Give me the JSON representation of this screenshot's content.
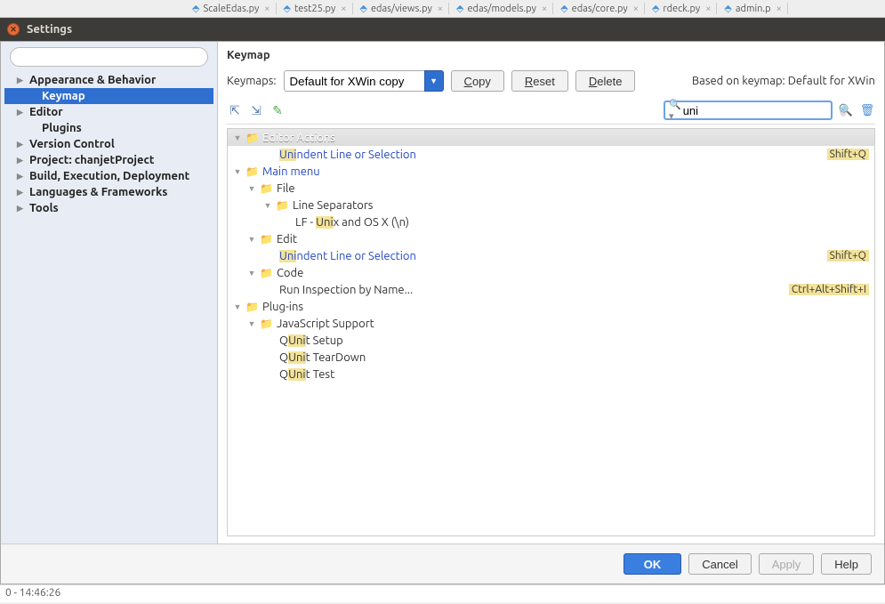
{
  "editorTabs": [
    "ScaleEdas.py",
    "test25.py",
    "edas/views.py",
    "edas/models.py",
    "edas/core.py",
    "rdeck.py",
    "admin.p"
  ],
  "windowTitle": "Settings",
  "sidebar": {
    "items": [
      {
        "label": "Appearance & Behavior",
        "bold": true,
        "arrow": true
      },
      {
        "label": "Keymap",
        "bold": true,
        "selected": true,
        "indent": true
      },
      {
        "label": "Editor",
        "bold": true,
        "arrow": true
      },
      {
        "label": "Plugins",
        "bold": true,
        "indent": true
      },
      {
        "label": "Version Control",
        "bold": true,
        "arrow": true
      },
      {
        "label": "Project: chanjetProject",
        "bold": true,
        "arrow": true
      },
      {
        "label": "Build, Execution, Deployment",
        "bold": true,
        "arrow": true
      },
      {
        "label": "Languages & Frameworks",
        "bold": true,
        "arrow": true
      },
      {
        "label": "Tools",
        "bold": true,
        "arrow": true
      }
    ]
  },
  "main": {
    "title": "Keymap",
    "keymapsLabel": "Keymaps:",
    "keymapsValue": "Default for XWin copy",
    "copy": "Copy",
    "reset": "Reset",
    "delete": "Delete",
    "basedOn": "Based on keymap: Default for XWin",
    "searchValue": "uni"
  },
  "tree": [
    {
      "ind": 0,
      "sel": true,
      "tw": "▼",
      "fold": "blue",
      "label": "Editor Actions",
      "white": true
    },
    {
      "ind": 3,
      "link": true,
      "pre": "",
      "hl": "Uni",
      "post": "ndent Line or Selection",
      "shortcut": "Shift+Q"
    },
    {
      "ind": 0,
      "tw": "▼",
      "fold": "blue",
      "link": true,
      "label": "Main menu"
    },
    {
      "ind": 1,
      "tw": "▼",
      "fold": "y",
      "label": "File"
    },
    {
      "ind": 2,
      "tw": "▼",
      "fold": "y",
      "label": "Line Separators"
    },
    {
      "ind": 4,
      "pre": "LF - ",
      "hl": "Uni",
      "post": "x and OS X (\\n)"
    },
    {
      "ind": 1,
      "tw": "▼",
      "fold": "y",
      "label": "Edit"
    },
    {
      "ind": 3,
      "link": true,
      "pre": "",
      "hl": "Uni",
      "post": "ndent Line or Selection",
      "shortcut": "Shift+Q"
    },
    {
      "ind": 1,
      "tw": "▼",
      "fold": "y",
      "label": "Code"
    },
    {
      "ind": 3,
      "label": "Run Inspection by Name...",
      "shortcut": "Ctrl+Alt+Shift+I"
    },
    {
      "ind": 0,
      "tw": "▼",
      "fold": "y",
      "label": "Plug-ins"
    },
    {
      "ind": 1,
      "tw": "▼",
      "fold": "y",
      "label": "JavaScript Support"
    },
    {
      "ind": 3,
      "pre": "Q",
      "hl": "Uni",
      "post": "t Setup"
    },
    {
      "ind": 3,
      "pre": "Q",
      "hl": "Uni",
      "post": "t TearDown"
    },
    {
      "ind": 3,
      "pre": "Q",
      "hl": "Uni",
      "post": "t Test"
    }
  ],
  "footer": {
    "ok": "OK",
    "cancel": "Cancel",
    "apply": "Apply",
    "help": "Help"
  },
  "status": "0 - 14:46:26"
}
